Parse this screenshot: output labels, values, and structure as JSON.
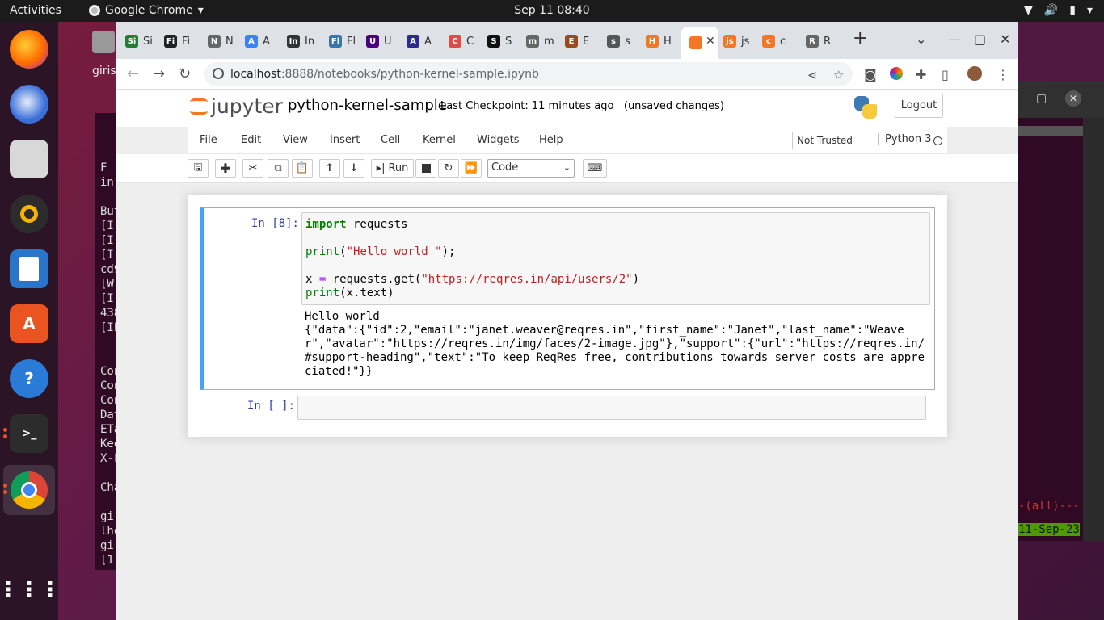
{
  "system": {
    "activities": "Activities",
    "app_name": "Google Chrome",
    "clock": "Sep 11  08:40"
  },
  "desktop": {
    "home_label": "giris",
    "term_lines": [
      "F",
      "in",
      "",
      "But",
      "[I",
      "[I",
      "[I",
      "cd9",
      "[W",
      "[I",
      "438",
      "[IP",
      "",
      "",
      "Con",
      "Con",
      "Con",
      "Dat",
      "ETa",
      "Kee",
      "X-F",
      "",
      "Cha",
      "",
      "gir",
      "lho",
      "gir",
      "[1"
    ],
    "term2_bottom1": "-(all)---",
    "term2_bottom2": "11-Sep-23"
  },
  "dock": {
    "items": [
      "firefox-icon",
      "thunderbird-icon",
      "files-icon",
      "rhythmbox-icon",
      "writer-icon",
      "software-icon",
      "help-icon",
      "terminal-icon",
      "chrome-icon",
      "app-grid-icon"
    ]
  },
  "browser": {
    "tabs": [
      {
        "icon": "Si",
        "label": "Si",
        "color": "#1e7e34"
      },
      {
        "icon": "Fi",
        "label": "Fi",
        "color": "#222222"
      },
      {
        "icon": "N",
        "label": "N",
        "color": "#666666"
      },
      {
        "icon": "A",
        "label": "A",
        "color": "#3b82f6"
      },
      {
        "icon": "In",
        "label": "In",
        "color": "#333333"
      },
      {
        "icon": "Fl",
        "label": "Fl",
        "color": "#3776ab"
      },
      {
        "icon": "U",
        "label": "U",
        "color": "#4b0082"
      },
      {
        "icon": "A",
        "label": "A",
        "color": "#2d2a8c"
      },
      {
        "icon": "C",
        "label": "C",
        "color": "#e24a4a"
      },
      {
        "icon": "S",
        "label": "S",
        "color": "#111111"
      },
      {
        "icon": "m",
        "label": "m",
        "color": "#666666"
      },
      {
        "icon": "E",
        "label": "E",
        "color": "#9c4a1a"
      },
      {
        "icon": "s",
        "label": "s",
        "color": "#555555"
      },
      {
        "icon": "H",
        "label": "H",
        "color": "#f37726"
      },
      {
        "icon": "",
        "label": "",
        "color": "#f37726"
      },
      {
        "icon": "js",
        "label": "js",
        "color": "#f37726"
      },
      {
        "icon": "c",
        "label": "c",
        "color": "#f37726"
      },
      {
        "icon": "R",
        "label": "R",
        "color": "#666666"
      }
    ],
    "url_host": "localhost",
    "url_path": ":8888/notebooks/python-kernel-sample.ipynb"
  },
  "jupyter": {
    "logo_text": "jupyter",
    "notebook_name": "python-kernel-sample",
    "checkpoint": "Last Checkpoint: 11 minutes ago",
    "unsaved": "(unsaved changes)",
    "logout": "Logout",
    "menu": [
      "File",
      "Edit",
      "View",
      "Insert",
      "Cell",
      "Kernel",
      "Widgets",
      "Help"
    ],
    "trusted": "Not Trusted",
    "kernel": "Python 3",
    "run_label": "Run",
    "cell_type": "Code",
    "cells": [
      {
        "prompt": "In [8]:",
        "output": "Hello world\n{\"data\":{\"id\":2,\"email\":\"janet.weaver@reqres.in\",\"first_name\":\"Janet\",\"last_name\":\"Weaver\",\"avatar\":\"https://reqres.in/img/faces/2-image.jpg\"},\"support\":{\"url\":\"https://reqres.in/#support-heading\",\"text\":\"To keep ReqRes free, contributions towards server costs are appreciated!\"}}"
      },
      {
        "prompt": "In [ ]:"
      }
    ],
    "code": {
      "kw_import": "import",
      "mod": " requests",
      "print1": "print",
      "str1": "\"Hello world \"",
      "tail1": ");",
      "var": "x ",
      "eq": "=",
      "call": " requests.get(",
      "str2": "\"https://reqres.in/api/users/2\"",
      "close2": ")",
      "print2": "print",
      "arg2": "(x.text)"
    }
  }
}
